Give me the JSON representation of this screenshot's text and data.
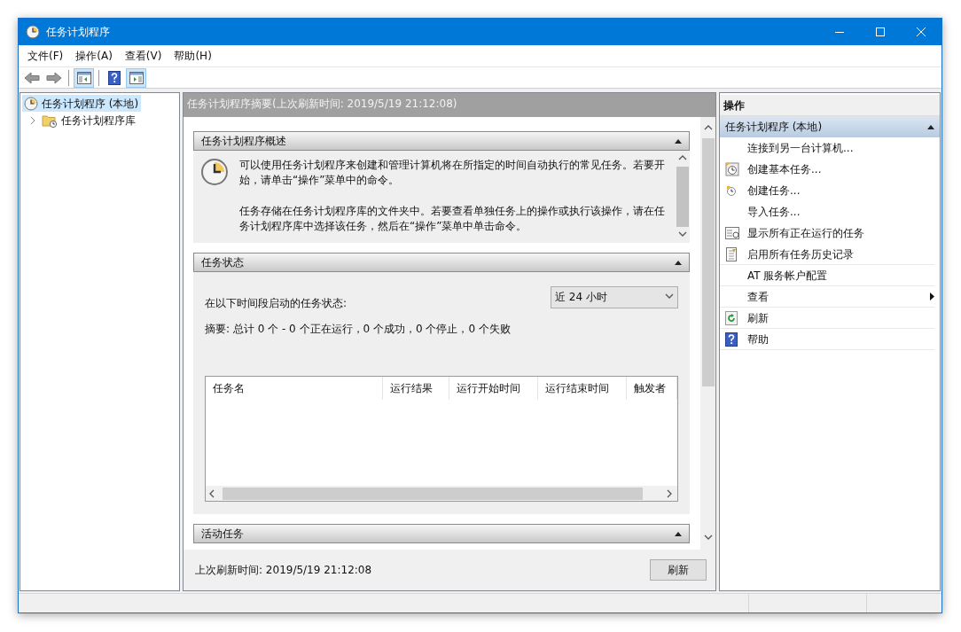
{
  "window": {
    "title": "任务计划程序"
  },
  "menu": [
    "文件(F)",
    "操作(A)",
    "查看(V)",
    "帮助(H)"
  ],
  "toolbar": [
    {
      "kind": "back",
      "selected": false
    },
    {
      "kind": "forward",
      "selected": false
    },
    {
      "kind": "console-tree",
      "selected": true
    },
    {
      "kind": "help",
      "selected": false
    },
    {
      "kind": "action-pane",
      "selected": true
    }
  ],
  "tree": [
    {
      "label": "任务计划程序 (本地)",
      "selected": true,
      "children": [
        {
          "label": "任务计划程序库",
          "selected": false,
          "expanded": false
        }
      ]
    }
  ],
  "summary": {
    "title": "任务计划程序摘要(上次刷新时间: 2019/5/19 21:12:08)",
    "sections": [
      {
        "kind": "overview",
        "title": "任务计划程序概述",
        "expanded": true,
        "paragraphs": [
          "可以使用任务计划程序来创建和管理计算机将在所指定的时间自动执行的常见任务。若要开始，请单击“操作”菜单中的命令。",
          "任务存储在任务计划程序库的文件夹中。若要查看单独任务上的操作或执行该操作，请在任务计划程序库中选择该任务，然后在“操作”菜单中单击命令。"
        ]
      },
      {
        "kind": "status",
        "title": "任务状态",
        "expanded": true,
        "period_label": "在以下时间段启动的任务状态:",
        "period": "近 24 小时",
        "summary": "摘要: 总计 0 个 - 0 个正在运行，0 个成功，0 个停止，0 个失败",
        "columns": [
          "任务名",
          "运行结果",
          "运行开始时间",
          "运行结束时间",
          "触发者"
        ]
      },
      {
        "kind": "active",
        "title": "活动任务",
        "expanded": true
      }
    ],
    "last_refresh": "上次刷新时间: 2019/5/19 21:12:08",
    "refresh_button": "刷新"
  },
  "actions": {
    "title": "操作",
    "group": {
      "title": "任务计划程序 (本地)",
      "expanded": true
    },
    "items": [
      {
        "label": "连接到另一台计算机...",
        "kind": "connect",
        "submenu": false
      },
      {
        "label": "创建基本任务...",
        "kind": "create-basic",
        "submenu": false
      },
      {
        "label": "创建任务...",
        "kind": "create",
        "submenu": false
      },
      {
        "label": "导入任务...",
        "kind": "import",
        "submenu": false
      },
      {
        "label": "显示所有正在运行的任务",
        "kind": "running",
        "submenu": false
      },
      {
        "label": "启用所有任务历史记录",
        "kind": "history",
        "submenu": false
      },
      {
        "label": "AT 服务帐户配置",
        "kind": "at",
        "submenu": false
      },
      {
        "label": "查看",
        "kind": "view",
        "submenu": true
      },
      {
        "label": "刷新",
        "kind": "refresh",
        "submenu": false
      },
      {
        "label": "帮助",
        "kind": "help",
        "submenu": false
      }
    ]
  }
}
